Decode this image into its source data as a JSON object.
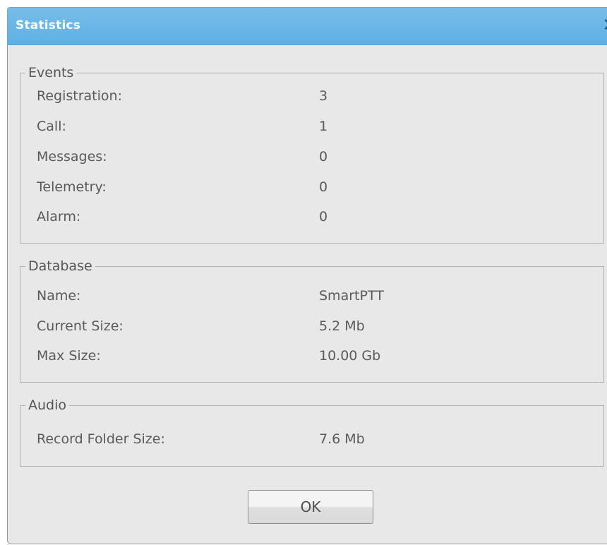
{
  "dialog": {
    "title": "Statistics",
    "close_glyph": "✕"
  },
  "events": {
    "legend": "Events",
    "rows": [
      {
        "label": "Registration:",
        "value": "3"
      },
      {
        "label": "Call:",
        "value": "1"
      },
      {
        "label": "Messages:",
        "value": "0"
      },
      {
        "label": "Telemetry:",
        "value": "0"
      },
      {
        "label": "Alarm:",
        "value": "0"
      }
    ]
  },
  "database": {
    "legend": "Database",
    "rows": [
      {
        "label": "Name:",
        "value": "SmartPTT"
      },
      {
        "label": "Current Size:",
        "value": "5.2 Mb"
      },
      {
        "label": "Max Size:",
        "value": "10.00 Gb"
      }
    ]
  },
  "audio": {
    "legend": "Audio",
    "rows": [
      {
        "label": "Record Folder Size:",
        "value": "7.6 Mb"
      }
    ]
  },
  "buttons": {
    "ok": "OK"
  },
  "colors": {
    "titlebar": "#6bb7e7",
    "title_text": "#ffffff",
    "close_icon": "#1e5a8e",
    "dialog_bg": "#e8e8e8"
  }
}
